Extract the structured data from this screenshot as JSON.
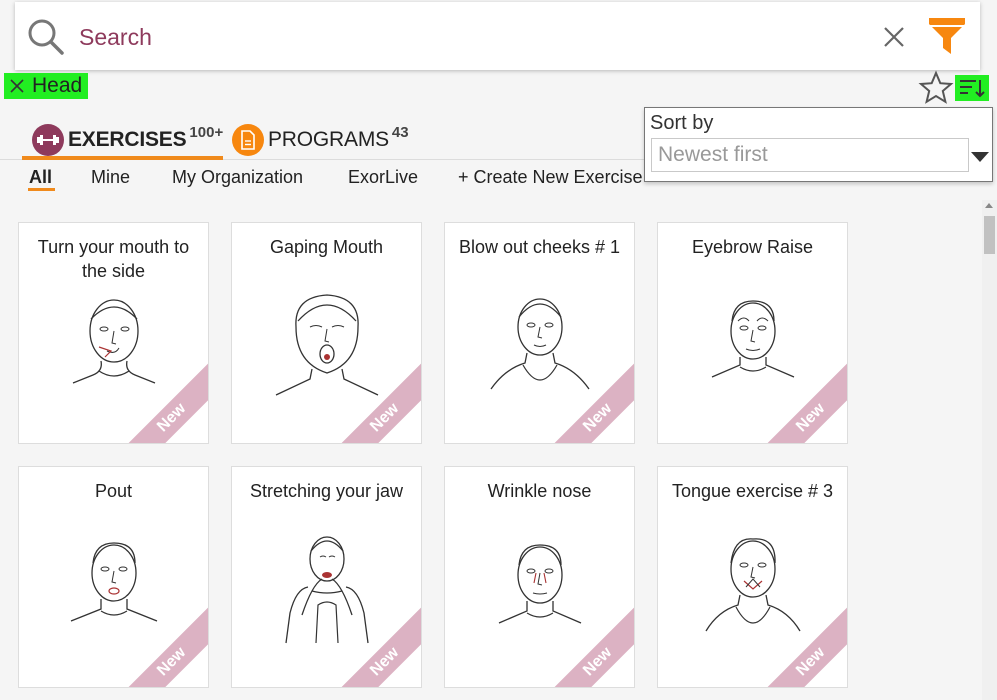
{
  "search": {
    "placeholder": "Search",
    "value": ""
  },
  "active_tag": {
    "label": "Head"
  },
  "tabs": [
    {
      "label": "EXERCISES",
      "count": "100+"
    },
    {
      "label": "PROGRAMS",
      "count": "43"
    }
  ],
  "subtabs": [
    {
      "label": "All"
    },
    {
      "label": "Mine"
    },
    {
      "label": "My Organization"
    },
    {
      "label": "ExorLive"
    },
    {
      "label": "+ Create New Exercise"
    }
  ],
  "sort": {
    "label": "Sort by",
    "selected": "Newest first"
  },
  "colors": {
    "accent": "#f08a1c",
    "brand": "#8e3a5c",
    "highlight": "#22ee22",
    "ribbon": "#dcb2c3"
  },
  "cards": [
    {
      "title": "Turn your mouth to the side",
      "badge": "New"
    },
    {
      "title": "Gaping Mouth",
      "badge": "New"
    },
    {
      "title": "Blow out cheeks # 1",
      "badge": "New"
    },
    {
      "title": "Eyebrow Raise",
      "badge": "New"
    },
    {
      "title": "Pout",
      "badge": "New"
    },
    {
      "title": "Stretching your jaw",
      "badge": "New"
    },
    {
      "title": "Wrinkle nose",
      "badge": "New"
    },
    {
      "title": "Tongue exercise # 3",
      "badge": "New"
    }
  ]
}
